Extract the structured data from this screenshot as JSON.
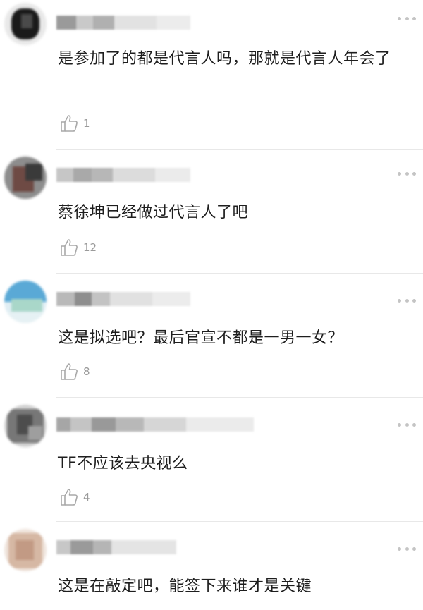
{
  "comments": [
    {
      "text": "是参加了的都是代言人吗，那就是代言人年会了",
      "likes": "1"
    },
    {
      "text": "蔡徐坤已经做过代言人了吧",
      "likes": "12"
    },
    {
      "text": "这是拟选吧？最后官宣不都是一男一女？",
      "likes": "8"
    },
    {
      "text": "TF不应该去央视么",
      "likes": "4"
    },
    {
      "text": "这是在敲定吧，能签下来谁才是关键",
      "likes": ""
    }
  ],
  "icons": {
    "like": "thumbs-up-icon",
    "more": "more-dots-icon"
  },
  "colors": {
    "divider": "#e8e8e8",
    "like_count": "#9a9a9a",
    "text": "#1e1e1e"
  }
}
